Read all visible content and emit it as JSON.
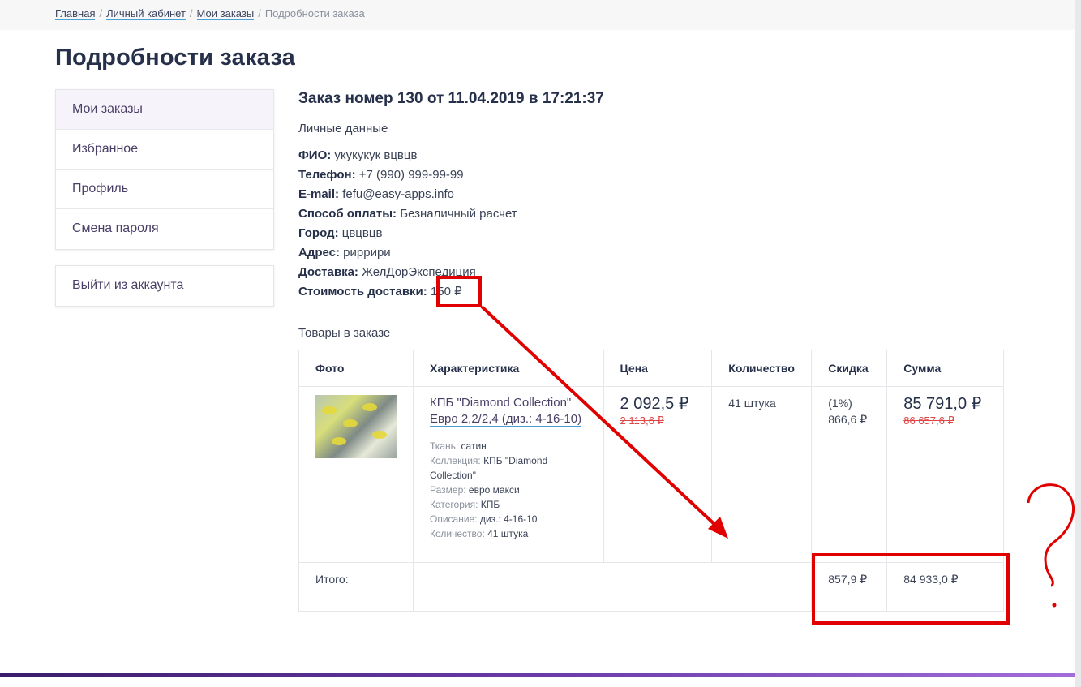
{
  "breadcrumb": {
    "items": [
      "Главная",
      "Личный кабинет",
      "Мои заказы"
    ],
    "current": "Подробности заказа"
  },
  "page": {
    "title": "Подробности заказа"
  },
  "sidebar": {
    "items": [
      {
        "label": "Мои заказы"
      },
      {
        "label": "Избранное"
      },
      {
        "label": "Профиль"
      },
      {
        "label": "Смена пароля"
      }
    ],
    "logout": "Выйти из аккаунта"
  },
  "order": {
    "title": "Заказ номер 130 от 11.04.2019 в 17:21:37",
    "personal_label": "Личные данные",
    "fields": [
      {
        "label": "ФИО:",
        "value": "укукукук вцвцв"
      },
      {
        "label": "Телефон:",
        "value": "+7 (990) 999-99-99"
      },
      {
        "label": "E-mail:",
        "value": "fefu@easy-apps.info"
      },
      {
        "label": "Способ оплаты:",
        "value": "Безналичный расчет"
      },
      {
        "label": "Город:",
        "value": "цвцвцв"
      },
      {
        "label": "Адрес:",
        "value": "риррири"
      },
      {
        "label": "Доставка:",
        "value": "ЖелДорЭкспедиция"
      },
      {
        "label": "Стоимость доставки:",
        "value": "150 ₽"
      }
    ],
    "goods_label": "Товары в заказе"
  },
  "table": {
    "headers": [
      "Фото",
      "Характеристика",
      "Цена",
      "Количество",
      "Скидка",
      "Сумма"
    ],
    "row": {
      "name": "КПБ \"Diamond Collection\" Евро 2,2/2,4 (диз.: 4-16-10)",
      "props": [
        {
          "k": "Ткань:",
          "v": "сатин"
        },
        {
          "k": "Коллекция:",
          "v": "КПБ \"Diamond Collection\""
        },
        {
          "k": "Размер:",
          "v": "евро макси"
        },
        {
          "k": "Категория:",
          "v": "КПБ"
        },
        {
          "k": "Описание:",
          "v": "диз.: 4-16-10"
        },
        {
          "k": "Количество:",
          "v": "41 штука"
        }
      ],
      "price": "2 092,5 ₽",
      "price_old": "2 113,6 ₽",
      "quantity": "41 штука",
      "discount_pct": "(1%)",
      "discount_value": "866,6 ₽",
      "sum": "85 791,0 ₽",
      "sum_old": "86 657,6 ₽"
    },
    "total": {
      "label": "Итого:",
      "discount": "857,9 ₽",
      "sum": "84 933,0 ₽"
    }
  },
  "colors": {
    "annotation": "#e00000",
    "link_underline": "#4a9fd6",
    "old_price": "#e04545"
  }
}
